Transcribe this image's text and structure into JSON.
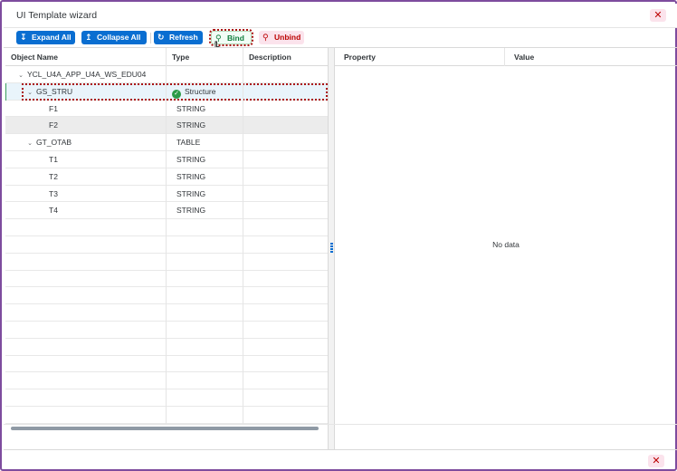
{
  "window": {
    "title": "UI Template wizard",
    "close_glyph": "✕"
  },
  "toolbar": {
    "expand_all": "Expand All",
    "collapse_all": "Collapse All",
    "refresh": "Refresh",
    "bind": "Bind",
    "unbind": "Unbind",
    "expand_icon": "↧",
    "collapse_icon": "↥",
    "refresh_icon": "↻",
    "bind_icon": "⚲",
    "unbind_icon": "⚲"
  },
  "left_table": {
    "columns": [
      "Object Name",
      "Type",
      "Description"
    ],
    "rows": [
      {
        "name": "YCL_U4A_APP_U4A_WS_EDU04",
        "type": "",
        "description": "",
        "level": 0,
        "expanded": true
      },
      {
        "name": "GS_STRU",
        "type": "Structure",
        "description": "",
        "level": 1,
        "expanded": true,
        "selected": true,
        "status": "success"
      },
      {
        "name": "F1",
        "type": "STRING",
        "description": "",
        "level": 2
      },
      {
        "name": "F2",
        "type": "STRING",
        "description": "",
        "level": 2,
        "alt": true
      },
      {
        "name": "GT_OTAB",
        "type": "TABLE",
        "description": "",
        "level": 1,
        "expanded": true
      },
      {
        "name": "T1",
        "type": "STRING",
        "description": "",
        "level": 2
      },
      {
        "name": "T2",
        "type": "STRING",
        "description": "",
        "level": 2
      },
      {
        "name": "T3",
        "type": "STRING",
        "description": "",
        "level": 2
      },
      {
        "name": "T4",
        "type": "STRING",
        "description": "",
        "level": 2
      }
    ],
    "empty_rows": 12
  },
  "right_table": {
    "columns": [
      "Property",
      "Value"
    ],
    "empty_text": "No data"
  },
  "colors": {
    "accent": "#0a6ed1",
    "frame": "#7e4c9e",
    "success": "#2b9a47",
    "negative": "#bb0000"
  }
}
